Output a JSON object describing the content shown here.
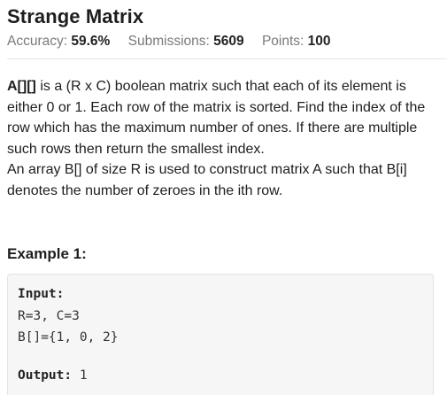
{
  "problem": {
    "title": "Strange Matrix",
    "stats": {
      "accuracy_label": "Accuracy:",
      "accuracy_value": "59.6%",
      "submissions_label": "Submissions:",
      "submissions_value": "5609",
      "points_label": "Points:",
      "points_value": "100"
    }
  },
  "statement": {
    "matrix_name": "A[][]",
    "paragraph_1": " is a (R x C) boolean matrix  such that each of its element is either 0 or 1. Each row of the matrix is sorted. Find the index of the row which has the maximum number of ones. If there are multiple such rows then return the smallest index.",
    "paragraph_2": "An array B[] of size R is used to construct matrix A such that B[i] denotes the number of zeroes in the ith row."
  },
  "example": {
    "heading": "Example 1:",
    "input_label": "Input:",
    "input_line_1": "R=3, C=3",
    "input_line_2": "B[]={1, 0, 2}",
    "output_label": "Output:",
    "output_value": " 1"
  }
}
